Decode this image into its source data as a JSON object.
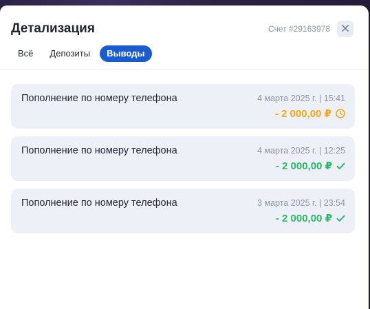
{
  "modal": {
    "title": "Детализация",
    "account": "Счет #29163978",
    "close_icon": "close-icon"
  },
  "tabs": [
    {
      "label": "Всё",
      "active": false
    },
    {
      "label": "Депозиты",
      "active": false
    },
    {
      "label": "Выводы",
      "active": true
    }
  ],
  "transactions": [
    {
      "title": "Пополнение по номеру телефона",
      "date": "4 марта 2025 г. | 15:41",
      "amount": "- 2 000,00 ₽",
      "status": "pending",
      "status_icon": "clock-icon",
      "color": "#f0a818"
    },
    {
      "title": "Пополнение по номеру телефона",
      "date": "4 марта 2025 г. | 12:25",
      "amount": "- 2 000,00 ₽",
      "status": "success",
      "status_icon": "check-icon",
      "color": "#2bb866"
    },
    {
      "title": "Пополнение по номеру телефона",
      "date": "3 марта 2025 г. | 23:54",
      "amount": "- 2 000,00 ₽",
      "status": "success",
      "status_icon": "check-icon",
      "color": "#2bb866"
    }
  ],
  "colors": {
    "accent": "#1a5ccf",
    "pending": "#f0a818",
    "success": "#2bb866"
  }
}
